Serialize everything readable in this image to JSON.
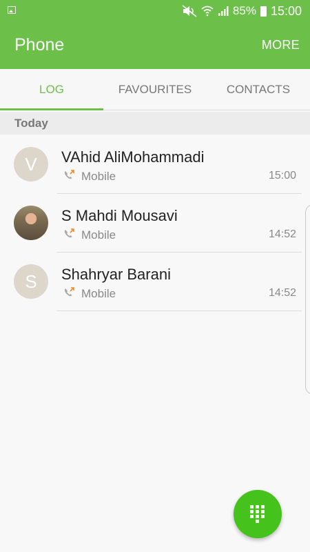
{
  "status_bar": {
    "battery": "85%",
    "time": "15:00",
    "icons": [
      "gallery-icon",
      "mute-icon",
      "wifi-icon",
      "signal-icon",
      "battery-icon"
    ]
  },
  "app_bar": {
    "title": "Phone",
    "more_label": "MORE"
  },
  "tabs": [
    {
      "label": "LOG",
      "active": true
    },
    {
      "label": "FAVOURITES",
      "active": false
    },
    {
      "label": "CONTACTS",
      "active": false
    }
  ],
  "log": {
    "section_title": "Today",
    "items": [
      {
        "initial": "V",
        "name": "VAhid AliMohammadi",
        "type": "Mobile",
        "time": "15:00",
        "avatar": "letter"
      },
      {
        "initial": "",
        "name": "S Mahdi Mousavi",
        "type": "Mobile",
        "time": "14:52",
        "avatar": "photo"
      },
      {
        "initial": "S",
        "name": "Shahryar Barani",
        "type": "Mobile",
        "time": "14:52",
        "avatar": "letter"
      }
    ]
  },
  "fab": {
    "icon": "dialpad-icon"
  },
  "colors": {
    "accent": "#6cc04a",
    "fab": "#45c21c",
    "outgoing_arrow": "#f08a24"
  }
}
